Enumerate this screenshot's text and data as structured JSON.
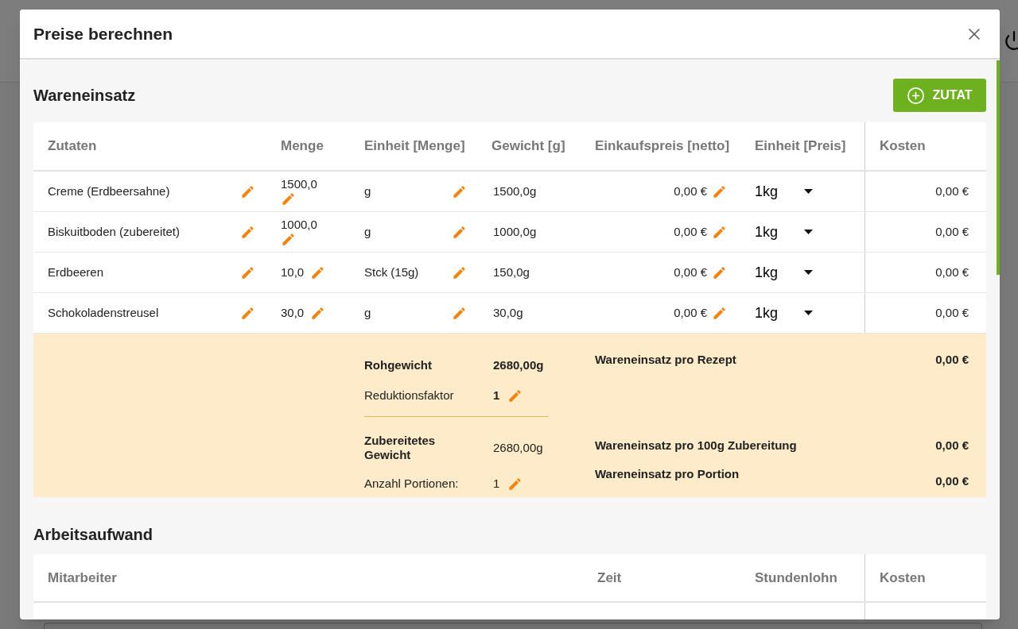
{
  "dialog": {
    "title": "Preise berechnen"
  },
  "ingredients": {
    "title": "Wareneinsatz",
    "add_button": "ZUTAT",
    "columns": [
      "Zutaten",
      "Menge",
      "Einheit [Menge]",
      "Gewicht [g]",
      "Einkaufspreis [netto]",
      "Einheit [Preis]",
      "Kosten"
    ],
    "rows": [
      {
        "name": "Creme (Erdbeersahne)",
        "amount": "1500,0",
        "unit": "g",
        "weight": "1500,0g",
        "price": "0,00 €",
        "price_unit": "1kg",
        "cost": "0,00 €"
      },
      {
        "name": "Biskuitboden (zubereitet)",
        "amount": "1000,0",
        "unit": "g",
        "weight": "1000,0g",
        "price": "0,00 €",
        "price_unit": "1kg",
        "cost": "0,00 €"
      },
      {
        "name": "Erdbeeren",
        "amount": "10,0",
        "unit": "Stck (15g)",
        "weight": "150,0g",
        "price": "0,00 €",
        "price_unit": "1kg",
        "cost": "0,00 €"
      },
      {
        "name": "Schokoladenstreusel",
        "amount": "30,0",
        "unit": "g",
        "weight": "30,0g",
        "price": "0,00 €",
        "price_unit": "1kg",
        "cost": "0,00 €"
      }
    ],
    "summary": {
      "left": [
        {
          "label": "Rohgewicht",
          "value": "2680,00g",
          "label_bold": true,
          "value_bold": true,
          "editable": false
        },
        {
          "label": "Reduktionsfaktor",
          "value": "1",
          "label_bold": false,
          "value_bold": true,
          "editable": true
        },
        {
          "label": "Zubereitetes Gewicht",
          "value": "2680,00g",
          "label_bold": true,
          "value_bold": false,
          "editable": false
        },
        {
          "label": "Anzahl Portionen:",
          "value": "1",
          "label_bold": false,
          "value_bold": false,
          "editable": true
        }
      ],
      "right": [
        {
          "label": "Wareneinsatz pro Rezept",
          "value": "0,00 €"
        },
        {
          "label": "Wareneinsatz pro 100g Zubereitung",
          "value": "0,00 €"
        },
        {
          "label": "Wareneinsatz pro Portion",
          "value": "0,00 €"
        }
      ]
    }
  },
  "labor": {
    "title": "Arbeitsaufwand",
    "columns": [
      "Mitarbeiter",
      "Zeit",
      "Stundenlohn",
      "Kosten"
    ]
  }
}
